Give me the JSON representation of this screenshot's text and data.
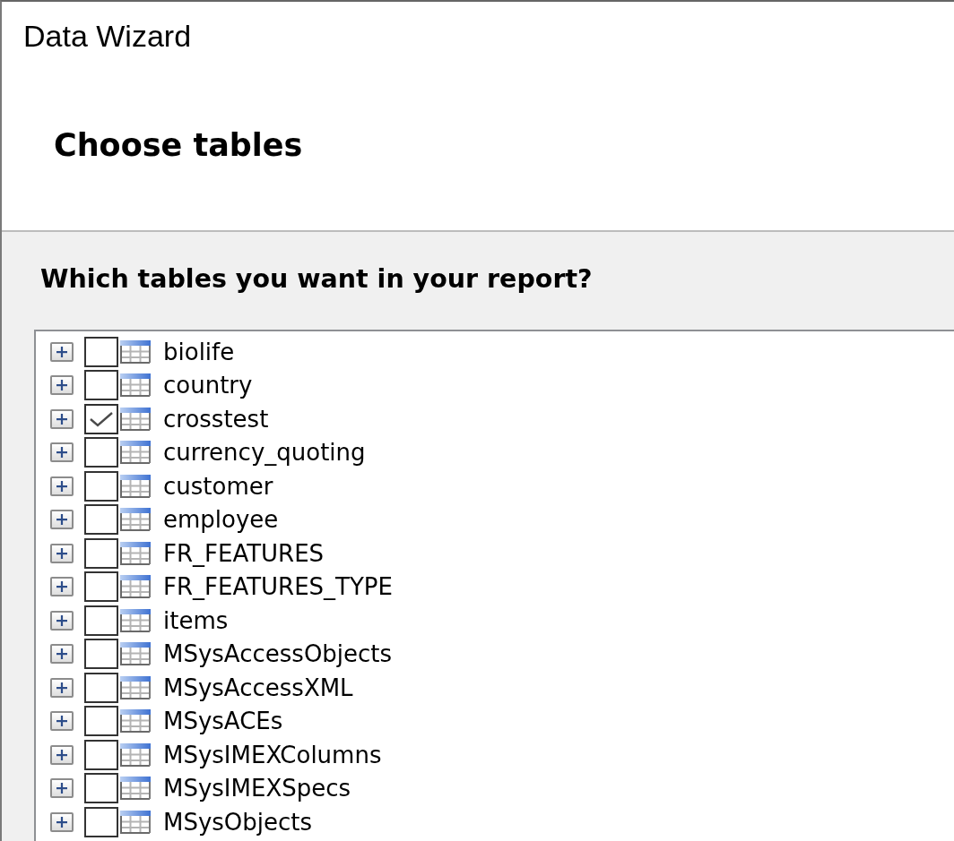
{
  "window": {
    "title": "Data Wizard"
  },
  "header": {
    "heading": "Choose tables"
  },
  "prompt": "Which tables you want in your report?",
  "tables": [
    {
      "name": "biolife",
      "checked": false,
      "expanded": false
    },
    {
      "name": "country",
      "checked": false,
      "expanded": false
    },
    {
      "name": "crosstest",
      "checked": true,
      "expanded": false
    },
    {
      "name": "currency_quoting",
      "checked": false,
      "expanded": false
    },
    {
      "name": "customer",
      "checked": false,
      "expanded": false
    },
    {
      "name": "employee",
      "checked": false,
      "expanded": false
    },
    {
      "name": "FR_FEATURES",
      "checked": false,
      "expanded": false
    },
    {
      "name": "FR_FEATURES_TYPE",
      "checked": false,
      "expanded": false
    },
    {
      "name": "items",
      "checked": false,
      "expanded": false
    },
    {
      "name": "MSysAccessObjects",
      "checked": false,
      "expanded": false
    },
    {
      "name": "MSysAccessXML",
      "checked": false,
      "expanded": false
    },
    {
      "name": "MSysACEs",
      "checked": false,
      "expanded": false
    },
    {
      "name": "MSysIMEXColumns",
      "checked": false,
      "expanded": false
    },
    {
      "name": "MSysIMEXSpecs",
      "checked": false,
      "expanded": false
    },
    {
      "name": "MSysObjects",
      "checked": false,
      "expanded": false
    }
  ]
}
